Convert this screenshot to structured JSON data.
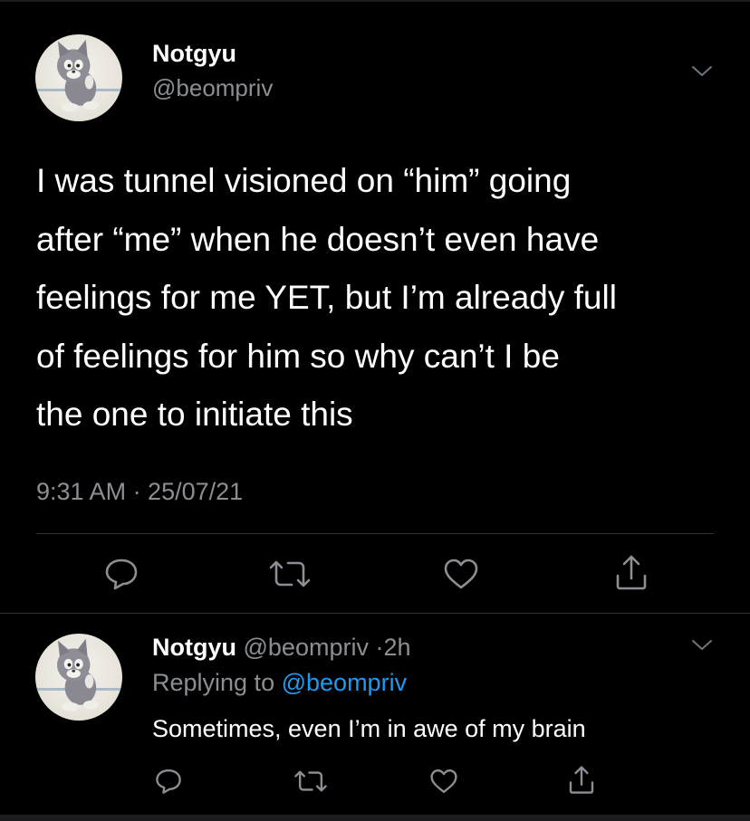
{
  "main_tweet": {
    "author_name": "Notgyu",
    "author_handle": "@beompriv",
    "text_lines": [
      "I was tunnel visioned on “him” going",
      "after “me” when he doesn’t even have",
      "feelings for me YET, but I’m already full",
      "of feelings for him so why can’t I be",
      "the one to initiate this"
    ],
    "timestamp": "9:31 AM · 25/07/21",
    "actions": [
      "reply-icon",
      "retweet-icon",
      "like-icon",
      "share-icon"
    ]
  },
  "reply_tweet": {
    "author_name": "Notgyu",
    "author_handle": "@beompriv",
    "separator": "·",
    "time": "2h",
    "replying_prefix": "Replying to",
    "replying_handle": "@beompriv",
    "text": "Sometimes, even I’m in awe of my brain",
    "actions": [
      "reply-icon",
      "retweet-icon",
      "like-icon",
      "share-icon"
    ]
  },
  "colors": {
    "background": "#000000",
    "text": "#ffffff",
    "secondary_text": "#8b8f93",
    "link": "#1d9bf0",
    "divider": "#2f3336"
  }
}
